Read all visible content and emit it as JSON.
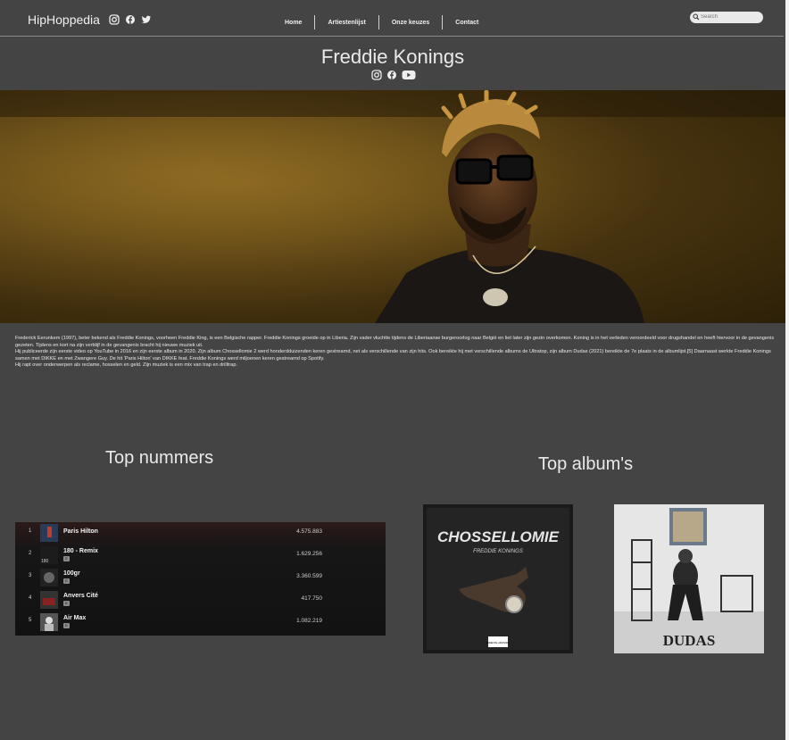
{
  "header": {
    "logo": "HipHoppedia",
    "social_icons": [
      "instagram-icon",
      "facebook-icon",
      "twitter-icon"
    ],
    "nav": [
      "Home",
      "Artiestenlijst",
      "Onze keuzes",
      "Contact"
    ],
    "search_placeholder": "Search"
  },
  "artist": {
    "name": "Freddie Konings",
    "social_icons": [
      "instagram-icon",
      "facebook-icon",
      "youtube-icon"
    ],
    "bio": [
      "Frederick Eerunkem (1997), beter bekend als Freddie Konings, voorheen Freddie King, is een Belgische rapper. Freddie Konings groeide op in Liberia. Zijn vader vluchtte tijdens de Liberiaanse burgeroorlog naar België en liet later zijn gezin overkomen. Koning is in het verleden veroordeeld voor drugshandel en heeft hiervoor in de gevangenis gezeten. Tijdens en kort na zijn verblijf in de gevangenis bracht hij nieuwe muziek uit.",
      "Hij publiceerde zijn eerste video op YouTube in 2016 en zijn eerste album in 2020. Zijn album Chossellomie 2 werd honderdduizenden keren gestreamd, net als verschillende van zijn hits. Ook bereikte hij met verschillende albums de Ultratop, zijn album Dudas (2021) bereikte de 7e plaats in de albumlijst.[5] Daarnaast werkte Freddie Konings samen met DIKKE en met Zwangere Guy. De hit 'Paris Hilton' van DIKKE feat. Freddie Konings werd miljoenen keren gestreamd op Spotify.",
      "Hij rapt over onderwerpen als reclame, hosselen en geld. Zijn muziek is een mix van trap en drilltrap."
    ]
  },
  "top_tracks": {
    "title": "Top nummers",
    "tracks": [
      {
        "rank": "1",
        "name": "Paris Hilton",
        "plays": "4.575.883",
        "explicit": false
      },
      {
        "rank": "2",
        "name": "180 - Remix",
        "plays": "1.629.256",
        "explicit": true,
        "art_text": "180"
      },
      {
        "rank": "3",
        "name": "100gr",
        "plays": "3.360.599",
        "explicit": true
      },
      {
        "rank": "4",
        "name": "Anvers Cité",
        "plays": "417.750",
        "explicit": true
      },
      {
        "rank": "5",
        "name": "Air Max",
        "plays": "1.082.219",
        "explicit": true
      }
    ],
    "explicit_badge": "E"
  },
  "top_albums": {
    "title": "Top album's",
    "albums": [
      {
        "title": "CHOSSELLOMIE",
        "subtitle": "FREDDIE KONINGS",
        "advisory": "PARENTAL ADVISORY"
      },
      {
        "title": "DUDAS"
      }
    ]
  }
}
